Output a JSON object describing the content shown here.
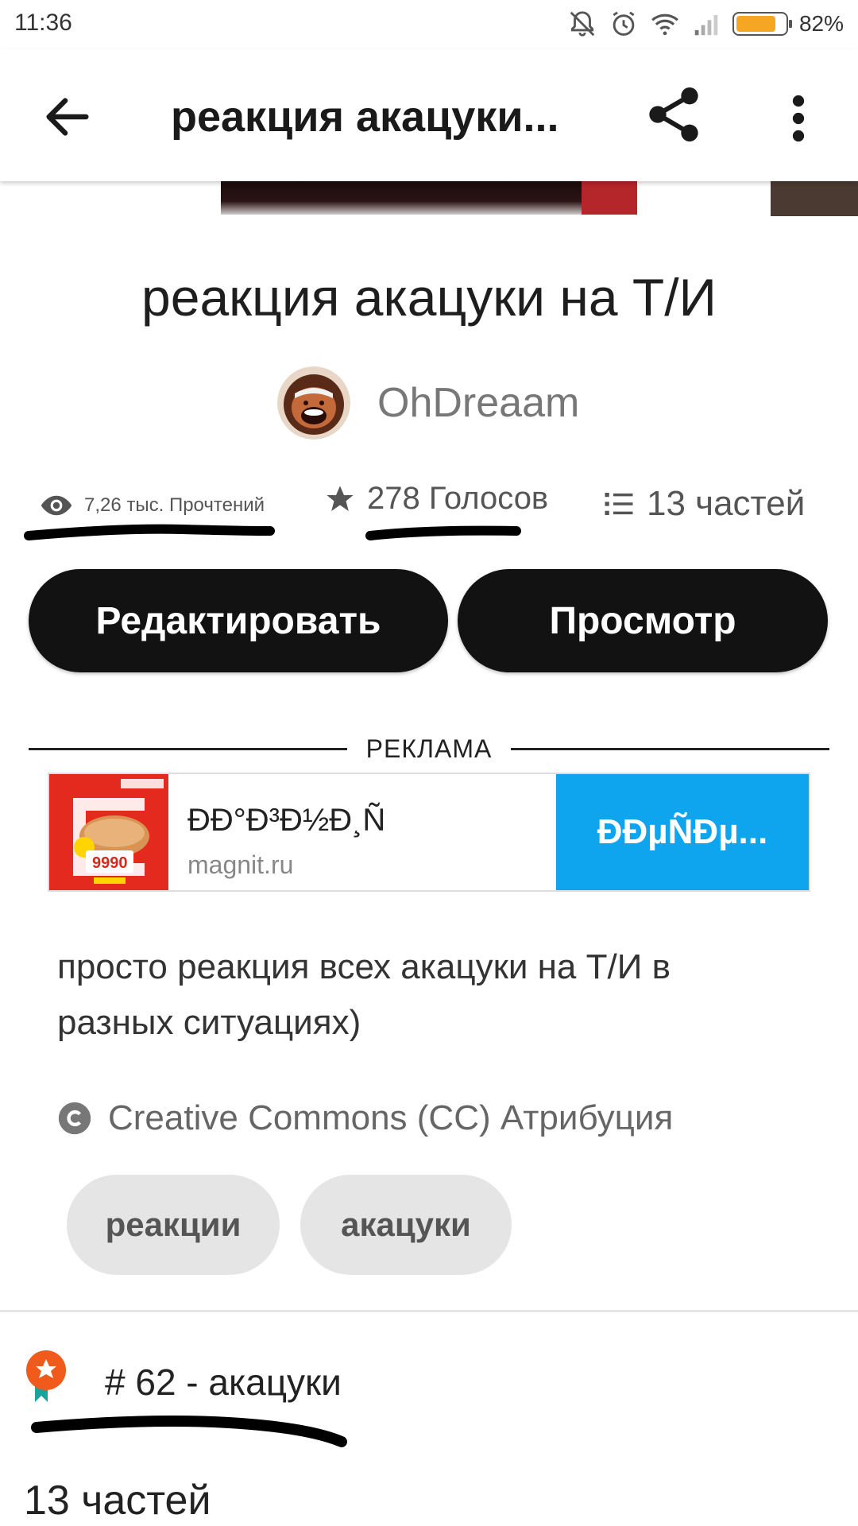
{
  "status_bar": {
    "time": "11:36",
    "battery_percent_label": "82%",
    "battery_level": 0.82
  },
  "app_bar": {
    "title": "реакция акацуки..."
  },
  "story": {
    "title": "реакция акацуки на Т/И",
    "author": "OhDreaam",
    "stats": {
      "reads": "7,26 тыс. Прочтений",
      "votes": "278 Голосов",
      "parts": "13 частей"
    },
    "buttons": {
      "edit": "Редактировать",
      "view": "Просмотр"
    },
    "description": "просто реакция всех акацуки на Т/И в разных ситуациях)",
    "license": "Creative Commons (CC) Атрибуция",
    "tags": [
      "реакции",
      "акацуки"
    ],
    "rank": "# 62 - акацуки",
    "parts_heading": "13 частей"
  },
  "ad": {
    "label": "РЕКЛАМА",
    "headline": "ÐÐ°Ð³Ð½Ð¸Ñ",
    "domain": "magnit.ru",
    "cta": "ÐÐµÑÐµ...",
    "image_price": "9990"
  },
  "colors": {
    "button_bg": "#121212",
    "ad_cta_bg": "#0ea5ee",
    "ad_image_bg": "#e42a1e",
    "battery": "#f5a623",
    "rank_badge": "#f05a1a"
  }
}
